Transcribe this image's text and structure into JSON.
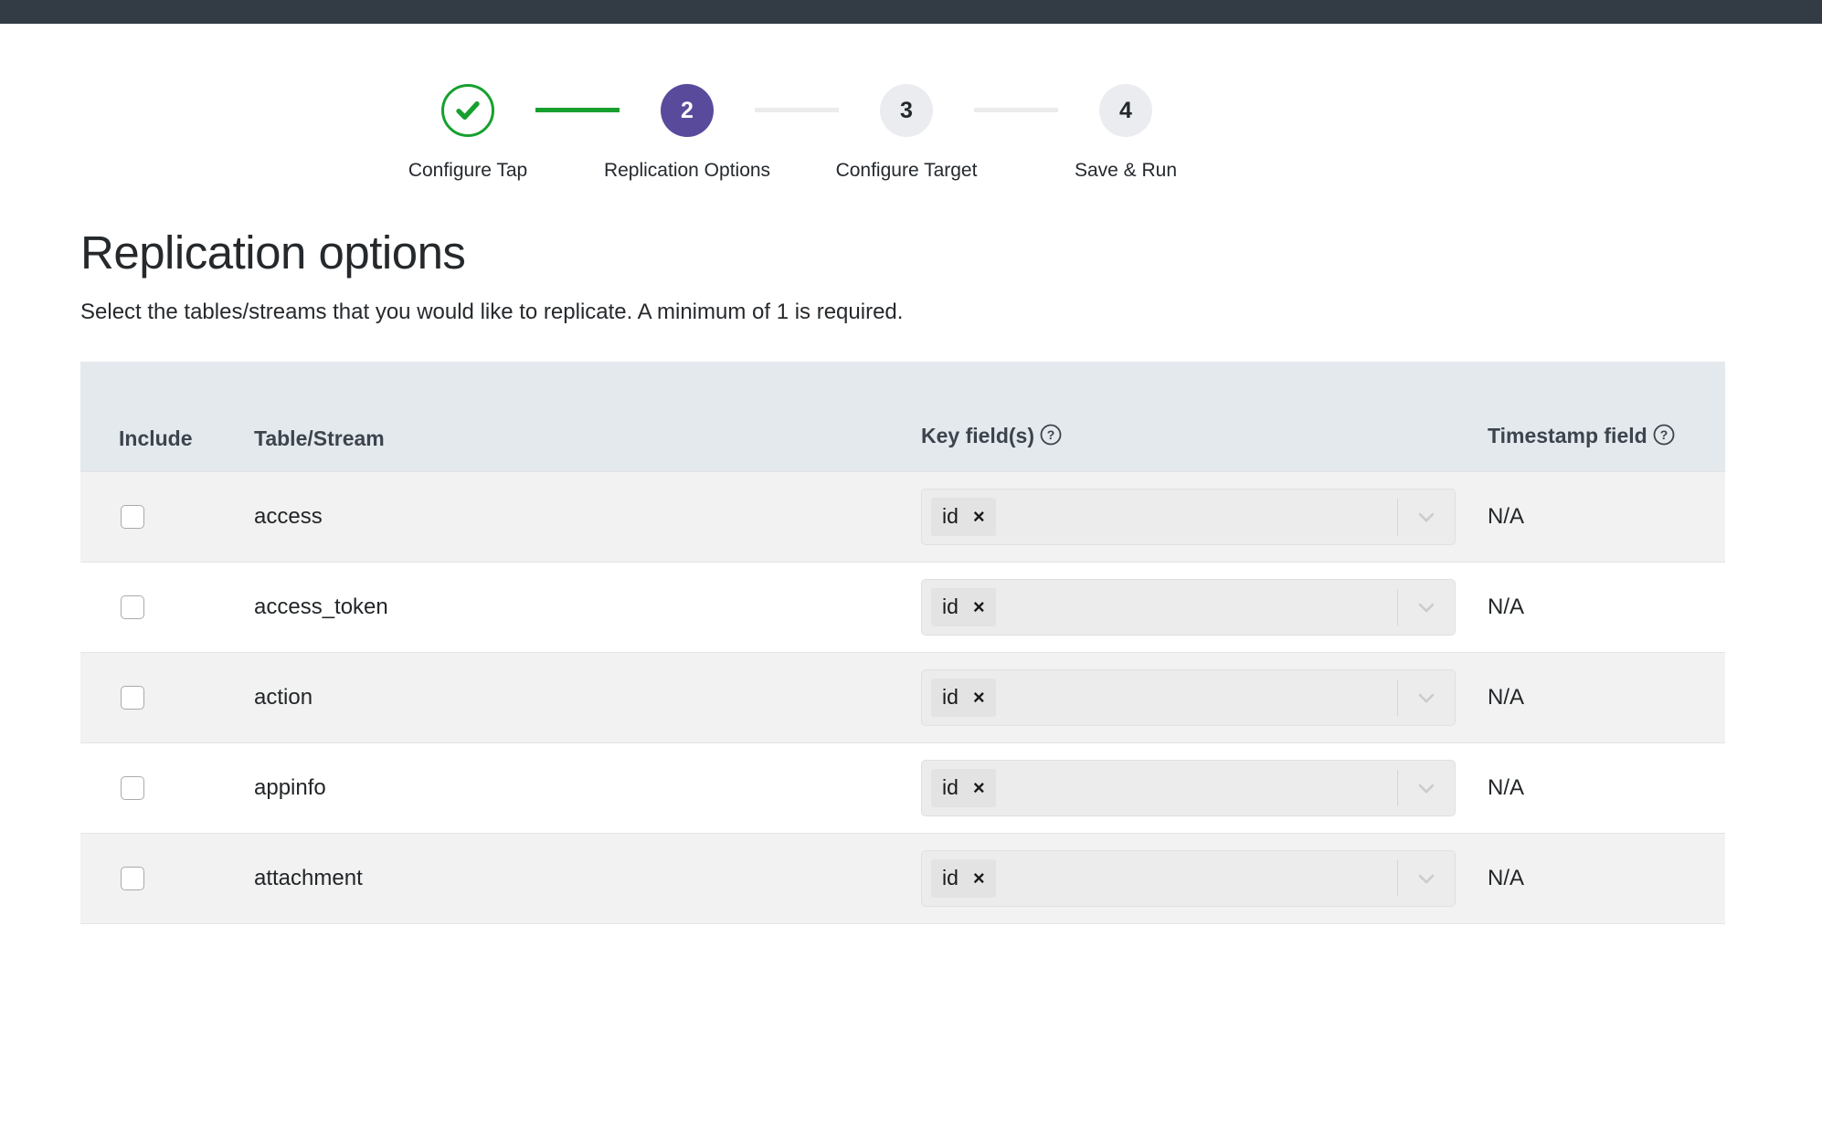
{
  "topbar": {
    "color": "#333b44"
  },
  "stepper": {
    "steps": [
      {
        "number": "1",
        "label": "Configure Tap",
        "state": "done",
        "icon": "check-icon"
      },
      {
        "number": "2",
        "label": "Replication Options",
        "state": "active",
        "icon": ""
      },
      {
        "number": "3",
        "label": "Configure Target",
        "state": "todo",
        "icon": ""
      },
      {
        "number": "4",
        "label": "Save & Run",
        "state": "todo",
        "icon": ""
      }
    ],
    "colors": {
      "done": "#17a02f",
      "active": "#5a4a9c",
      "todo": "#eaecef",
      "connector_filled": "#17a02f",
      "connector_empty": "#ececec"
    }
  },
  "main": {
    "title": "Replication options",
    "subtitle": "Select the tables/streams that you would like to replicate. A minimum of 1 is required."
  },
  "table": {
    "headers": {
      "include": "Include",
      "stream": "Table/Stream",
      "key_fields": "Key field(s)",
      "timestamp_field": "Timestamp field"
    },
    "help_icon": "question-circle-icon",
    "rows": [
      {
        "checked": false,
        "name": "access",
        "key_fields": [
          "id"
        ],
        "timestamp_field": "N/A"
      },
      {
        "checked": false,
        "name": "access_token",
        "key_fields": [
          "id"
        ],
        "timestamp_field": "N/A"
      },
      {
        "checked": false,
        "name": "action",
        "key_fields": [
          "id"
        ],
        "timestamp_field": "N/A"
      },
      {
        "checked": false,
        "name": "appinfo",
        "key_fields": [
          "id"
        ],
        "timestamp_field": "N/A"
      },
      {
        "checked": false,
        "name": "attachment",
        "key_fields": [
          "id"
        ],
        "timestamp_field": "N/A"
      }
    ]
  }
}
